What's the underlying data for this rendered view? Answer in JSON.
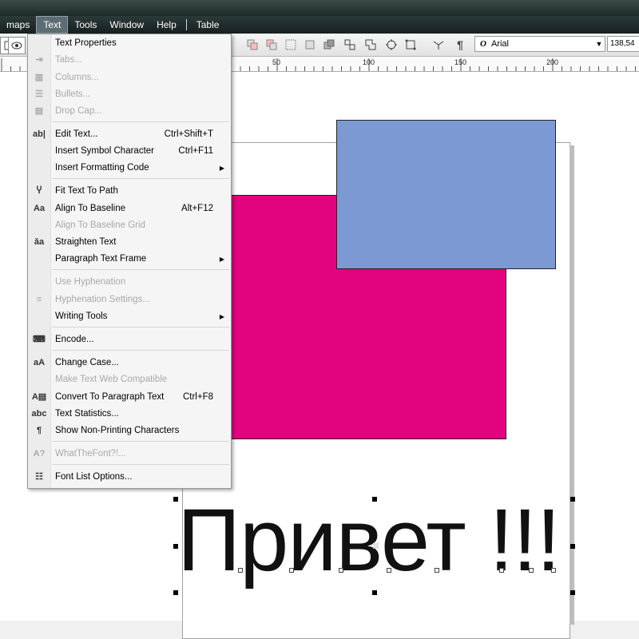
{
  "menubar": {
    "items": [
      "maps",
      "Text",
      "Tools",
      "Window",
      "Help",
      "Table"
    ]
  },
  "toolbar": {
    "font_name": "Arial",
    "font_size_partial": "138,54"
  },
  "ruler": {
    "ticks": [
      "50",
      "100",
      "150",
      "200"
    ]
  },
  "canvas": {
    "text": "Привет !!!",
    "colors": {
      "pink": "#e2047f",
      "blue": "#7d99d4"
    }
  },
  "text_menu": {
    "items": [
      {
        "label": "Text Properties",
        "icon": "",
        "shortcut": "",
        "disabled": false,
        "submenu": false
      },
      {
        "label": "Tabs...",
        "icon": "tabs-icon",
        "shortcut": "",
        "disabled": true,
        "submenu": false
      },
      {
        "label": "Columns...",
        "icon": "columns-icon",
        "shortcut": "",
        "disabled": true,
        "submenu": false
      },
      {
        "label": "Bullets...",
        "icon": "bullets-icon",
        "shortcut": "",
        "disabled": true,
        "submenu": false
      },
      {
        "label": "Drop Cap...",
        "icon": "drop-cap-icon",
        "shortcut": "",
        "disabled": true,
        "submenu": false
      },
      {
        "label": "Edit Text...",
        "icon": "edit-text-icon",
        "shortcut": "Ctrl+Shift+T",
        "disabled": false,
        "submenu": false
      },
      {
        "label": "Insert Symbol Character",
        "icon": "",
        "shortcut": "Ctrl+F11",
        "disabled": false,
        "submenu": false
      },
      {
        "label": "Insert Formatting Code",
        "icon": "",
        "shortcut": "",
        "disabled": false,
        "submenu": true
      },
      {
        "label": "Fit Text To Path",
        "icon": "fit-text-path-icon",
        "shortcut": "",
        "disabled": false,
        "submenu": false
      },
      {
        "label": "Align To Baseline",
        "icon": "align-baseline-icon",
        "shortcut": "Alt+F12",
        "disabled": false,
        "submenu": false
      },
      {
        "label": "Align To Baseline Grid",
        "icon": "",
        "shortcut": "",
        "disabled": true,
        "submenu": false
      },
      {
        "label": "Straighten Text",
        "icon": "straighten-text-icon",
        "shortcut": "",
        "disabled": false,
        "submenu": false
      },
      {
        "label": "Paragraph Text Frame",
        "icon": "",
        "shortcut": "",
        "disabled": false,
        "submenu": true
      },
      {
        "label": "Use Hyphenation",
        "icon": "",
        "shortcut": "",
        "disabled": true,
        "submenu": false
      },
      {
        "label": "Hyphenation Settings...",
        "icon": "hyphenation-icon",
        "shortcut": "",
        "disabled": true,
        "submenu": false
      },
      {
        "label": "Writing Tools",
        "icon": "",
        "shortcut": "",
        "disabled": false,
        "submenu": true
      },
      {
        "label": "Encode...",
        "icon": "encode-icon",
        "shortcut": "",
        "disabled": false,
        "submenu": false
      },
      {
        "label": "Change Case...",
        "icon": "change-case-icon",
        "shortcut": "",
        "disabled": false,
        "submenu": false
      },
      {
        "label": "Make Text Web Compatible",
        "icon": "",
        "shortcut": "",
        "disabled": true,
        "submenu": false
      },
      {
        "label": "Convert To Paragraph Text",
        "icon": "convert-paragraph-icon",
        "shortcut": "Ctrl+F8",
        "disabled": false,
        "submenu": false
      },
      {
        "label": "Text Statistics...",
        "icon": "text-statistics-icon",
        "shortcut": "",
        "disabled": false,
        "submenu": false
      },
      {
        "label": "Show Non-Printing Characters",
        "icon": "pilcrow-icon",
        "shortcut": "",
        "disabled": false,
        "submenu": false
      },
      {
        "label": "WhatTheFont?!...",
        "icon": "whatthefont-icon",
        "shortcut": "",
        "disabled": true,
        "submenu": false
      },
      {
        "label": "Font List Options...",
        "icon": "font-list-icon",
        "shortcut": "",
        "disabled": false,
        "submenu": false
      }
    ]
  }
}
